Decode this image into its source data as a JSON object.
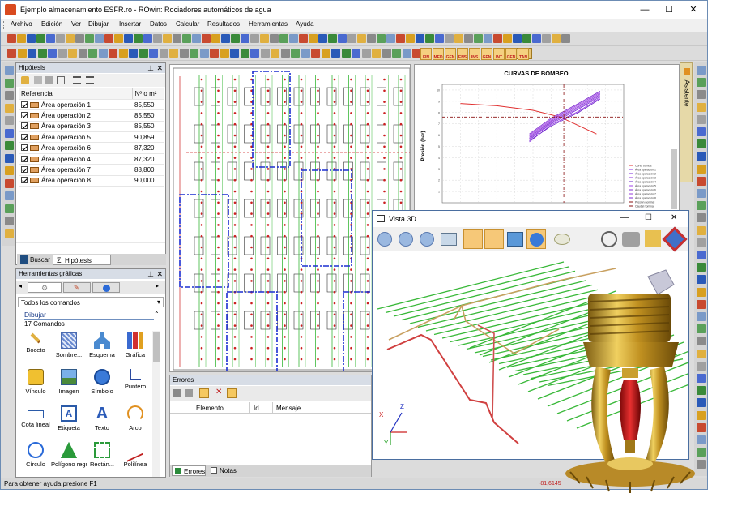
{
  "window": {
    "title": "Ejemplo almacenamiento ESFR.ro - ROwin: Rociadores automáticos de agua",
    "controls": [
      "—",
      "☐",
      "✕"
    ]
  },
  "menu": [
    "Archivo",
    "Edición",
    "Ver",
    "Dibujar",
    "Insertar",
    "Datos",
    "Calcular",
    "Resultados",
    "Herramientas",
    "Ayuda"
  ],
  "calc_buttons": [
    "FIN",
    "MED",
    "GEN",
    "ENS",
    "INS",
    "GEN",
    "INT",
    "GEN",
    "TAN"
  ],
  "hipotesis": {
    "title": "Hipótesis",
    "col_ref": "Referencia",
    "col_num": "Nº o m²",
    "rows": [
      {
        "name": "Área operación 1",
        "value": "85,550"
      },
      {
        "name": "Área operación 2",
        "value": "85,550"
      },
      {
        "name": "Área operación 3",
        "value": "85,550"
      },
      {
        "name": "Área operación 5",
        "value": "90,859"
      },
      {
        "name": "Área operación 6",
        "value": "87,320"
      },
      {
        "name": "Área operación 4",
        "value": "87,320"
      },
      {
        "name": "Área operación 7",
        "value": "88,800"
      },
      {
        "name": "Área operación 8",
        "value": "90,000"
      }
    ],
    "tab_buscar": "Buscar",
    "tab_hipotesis": "Hipótesis"
  },
  "herramientas": {
    "title": "Herramientas gráficas",
    "dropdown": "Todos los comandos",
    "group": "Dibujar",
    "count": "17 Comandos",
    "commands": [
      "Boceto",
      "Sombre...",
      "Esquema",
      "Gráfica",
      "Vínculo",
      "Imagen",
      "Símbolo",
      "Puntero",
      "Cota lineal",
      "Etiqueta",
      "Texto",
      "Arco",
      "Círculo",
      "Polígono regular",
      "Rectán...",
      "Polilínea"
    ]
  },
  "chart": {
    "title": "CURVAS DE BOMBEO",
    "ylabel": "Presión (bar)",
    "legend": [
      "Curva bomba",
      "Área operación 1",
      "Área operación 2",
      "Área operación 3",
      "Área operación 4",
      "Área operación 5",
      "Área operación 6",
      "Área operación 7",
      "Área operación 8",
      "Presión nominal",
      "Caudal nominal"
    ]
  },
  "chart_data": {
    "type": "line",
    "title": "CURVAS DE BOMBEO",
    "xlabel": "",
    "ylabel": "Presión (bar)",
    "y_ticks": [
      10,
      9,
      8,
      7,
      6,
      5,
      4,
      3,
      2,
      1
    ],
    "series": [
      {
        "name": "Curva bomba",
        "color": "#e03030",
        "values": [
          [
            0.1,
            8.8
          ],
          [
            0.3,
            8.6
          ],
          [
            0.5,
            8.2
          ],
          [
            0.65,
            7.6
          ],
          [
            0.85,
            6.1
          ]
        ]
      },
      {
        "name": "Área operación 1",
        "color": "#8a2be2",
        "values": [
          [
            0.48,
            5.4
          ],
          [
            0.6,
            6.9
          ],
          [
            0.75,
            8.1
          ],
          [
            0.87,
            9.3
          ]
        ]
      },
      {
        "name": "Área operación 2",
        "color": "#7a28d8",
        "values": [
          [
            0.48,
            5.6
          ],
          [
            0.6,
            7.0
          ],
          [
            0.75,
            8.3
          ],
          [
            0.87,
            9.4
          ]
        ]
      },
      {
        "name": "Área operación 3",
        "color": "#9030e0",
        "values": [
          [
            0.48,
            5.7
          ],
          [
            0.6,
            7.1
          ],
          [
            0.75,
            8.4
          ],
          [
            0.87,
            9.5
          ]
        ]
      },
      {
        "name": "Área operación 4",
        "color": "#6a22c8",
        "values": [
          [
            0.48,
            5.5
          ],
          [
            0.6,
            6.8
          ],
          [
            0.75,
            8.0
          ],
          [
            0.87,
            9.2
          ]
        ]
      },
      {
        "name": "Área operación 5",
        "color": "#a040e8",
        "values": [
          [
            0.48,
            5.9
          ],
          [
            0.6,
            7.3
          ],
          [
            0.75,
            8.6
          ],
          [
            0.87,
            9.7
          ]
        ]
      },
      {
        "name": "Área operación 6",
        "color": "#8030d0",
        "values": [
          [
            0.48,
            5.8
          ],
          [
            0.6,
            7.2
          ],
          [
            0.75,
            8.5
          ],
          [
            0.87,
            9.6
          ]
        ]
      },
      {
        "name": "Área operación 7",
        "color": "#9438dc",
        "values": [
          [
            0.48,
            6.0
          ],
          [
            0.6,
            7.4
          ],
          [
            0.75,
            8.7
          ],
          [
            0.87,
            9.8
          ]
        ]
      },
      {
        "name": "Área operación 8",
        "color": "#7c2ad0",
        "values": [
          [
            0.48,
            6.1
          ],
          [
            0.6,
            7.5
          ],
          [
            0.75,
            8.8
          ],
          [
            0.87,
            9.9
          ]
        ]
      }
    ],
    "reference_lines": {
      "Presión nominal": 7.6,
      "Caudal nominal": 0.67
    },
    "ylim": [
      0,
      10.5
    ],
    "xlim": [
      0,
      1
    ],
    "grid": true,
    "legend_position": "right"
  },
  "vista3d": {
    "title": "Vista 3D",
    "axis_x": "X",
    "axis_y": "Y",
    "axis_z": "Z"
  },
  "errores": {
    "title": "Errores",
    "col_elemento": "Elemento",
    "col_id": "Id",
    "col_mensaje": "Mensaje",
    "tab_errores": "Errores",
    "tab_notas": "Notas"
  },
  "asistente_tab": "Asistente",
  "status": {
    "help": "Para obtener ayuda presione F1",
    "coords": "-81,6145"
  },
  "colors": {
    "accent": "#6c8cb4",
    "pipe_red": "#cc2020",
    "pipe_green": "#38b838",
    "zone_blue": "#1c2ed0"
  }
}
